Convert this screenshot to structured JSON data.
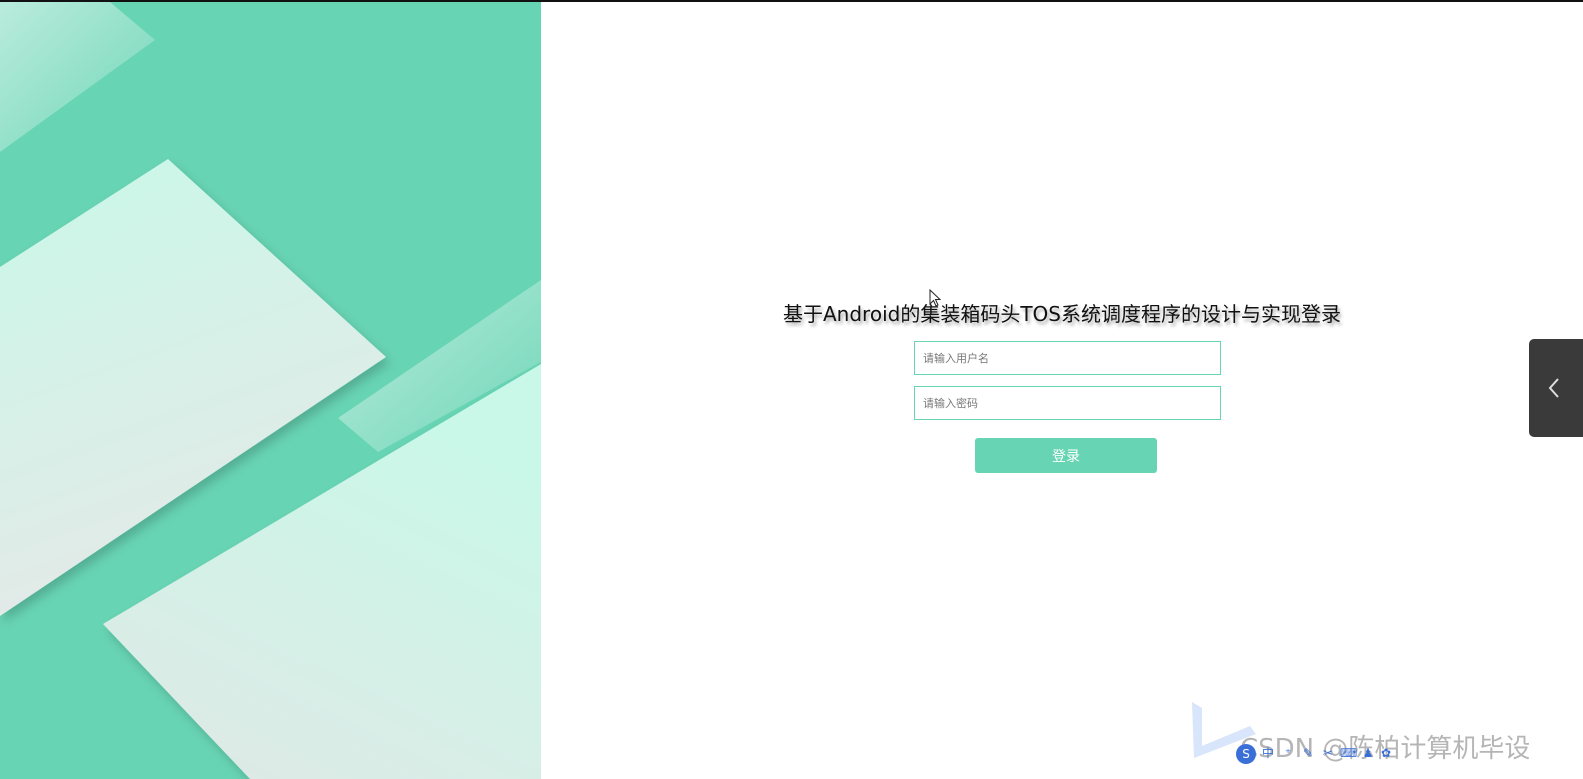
{
  "login": {
    "title": "基于Android的集装箱码头TOS系统调度程序的设计与实现登录",
    "username_placeholder": "请输入用户名",
    "password_placeholder": "请输入密码",
    "submit_label": "登录"
  },
  "watermark": {
    "text": "CSDN @陈柏计算机毕设"
  },
  "ime_toolbar": {
    "logo": "S",
    "buttons": [
      "中",
      "⁺",
      "✎",
      "✂",
      "⌨",
      "♟",
      "✿"
    ]
  },
  "icons": {
    "side_tab": "chevron-left-icon",
    "cursor": "mouse-cursor-icon"
  },
  "colors": {
    "accent": "#67d4b3",
    "panel_light": "#c9f5e8",
    "side_tab": "#3a3a3a"
  }
}
